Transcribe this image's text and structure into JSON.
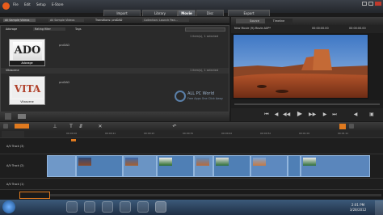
{
  "menu": [
    "File",
    "Edit",
    "Setup",
    "E-Store"
  ],
  "mode_tabs": [
    "Import",
    "Library",
    "Movie",
    "Disc",
    "Export"
  ],
  "active_tab": "Movie",
  "library": {
    "path_label": "All Sample Videos",
    "breadcrumb": "Transitions: proDAD",
    "tags_label": "Tags",
    "rating_label": "Rating filter",
    "collection_label": "Collection: Launch Pad...",
    "sections": [
      {
        "name": "Adorage",
        "info": "1 item(s), 1 selected",
        "item_label": "Adorage",
        "logo": "ADO"
      },
      {
        "name": "Vitascene",
        "info": "1 item(s), 1 selected",
        "item_label": "Vitascene",
        "logo": "VITA"
      }
    ],
    "source": "proDAD"
  },
  "preview": {
    "tabs": [
      "Source",
      "Timeline"
    ],
    "title": "New Movie (9).Movie.AXP*",
    "timecode": "00:00:00.00",
    "end_timecode": "00:00:00.00",
    "watermark_title": "ALL PC World",
    "watermark_sub": "Free Apps One Click Away"
  },
  "timeline": {
    "ruler_ticks": [
      "00:00:00",
      "00:00:10",
      "00:00:20",
      "00:00:30",
      "00:00:40",
      "00:00:50",
      "00:01:00",
      "00:01:10"
    ],
    "tracks": [
      "A/V Track (3)",
      "A/V Track (2)",
      "A/V Track (1)"
    ]
  },
  "clock": {
    "time": "2:01 PM",
    "date": "3/28/2012"
  },
  "colors": {
    "accent": "#e07a1f",
    "clip": "#4f7fb5"
  }
}
